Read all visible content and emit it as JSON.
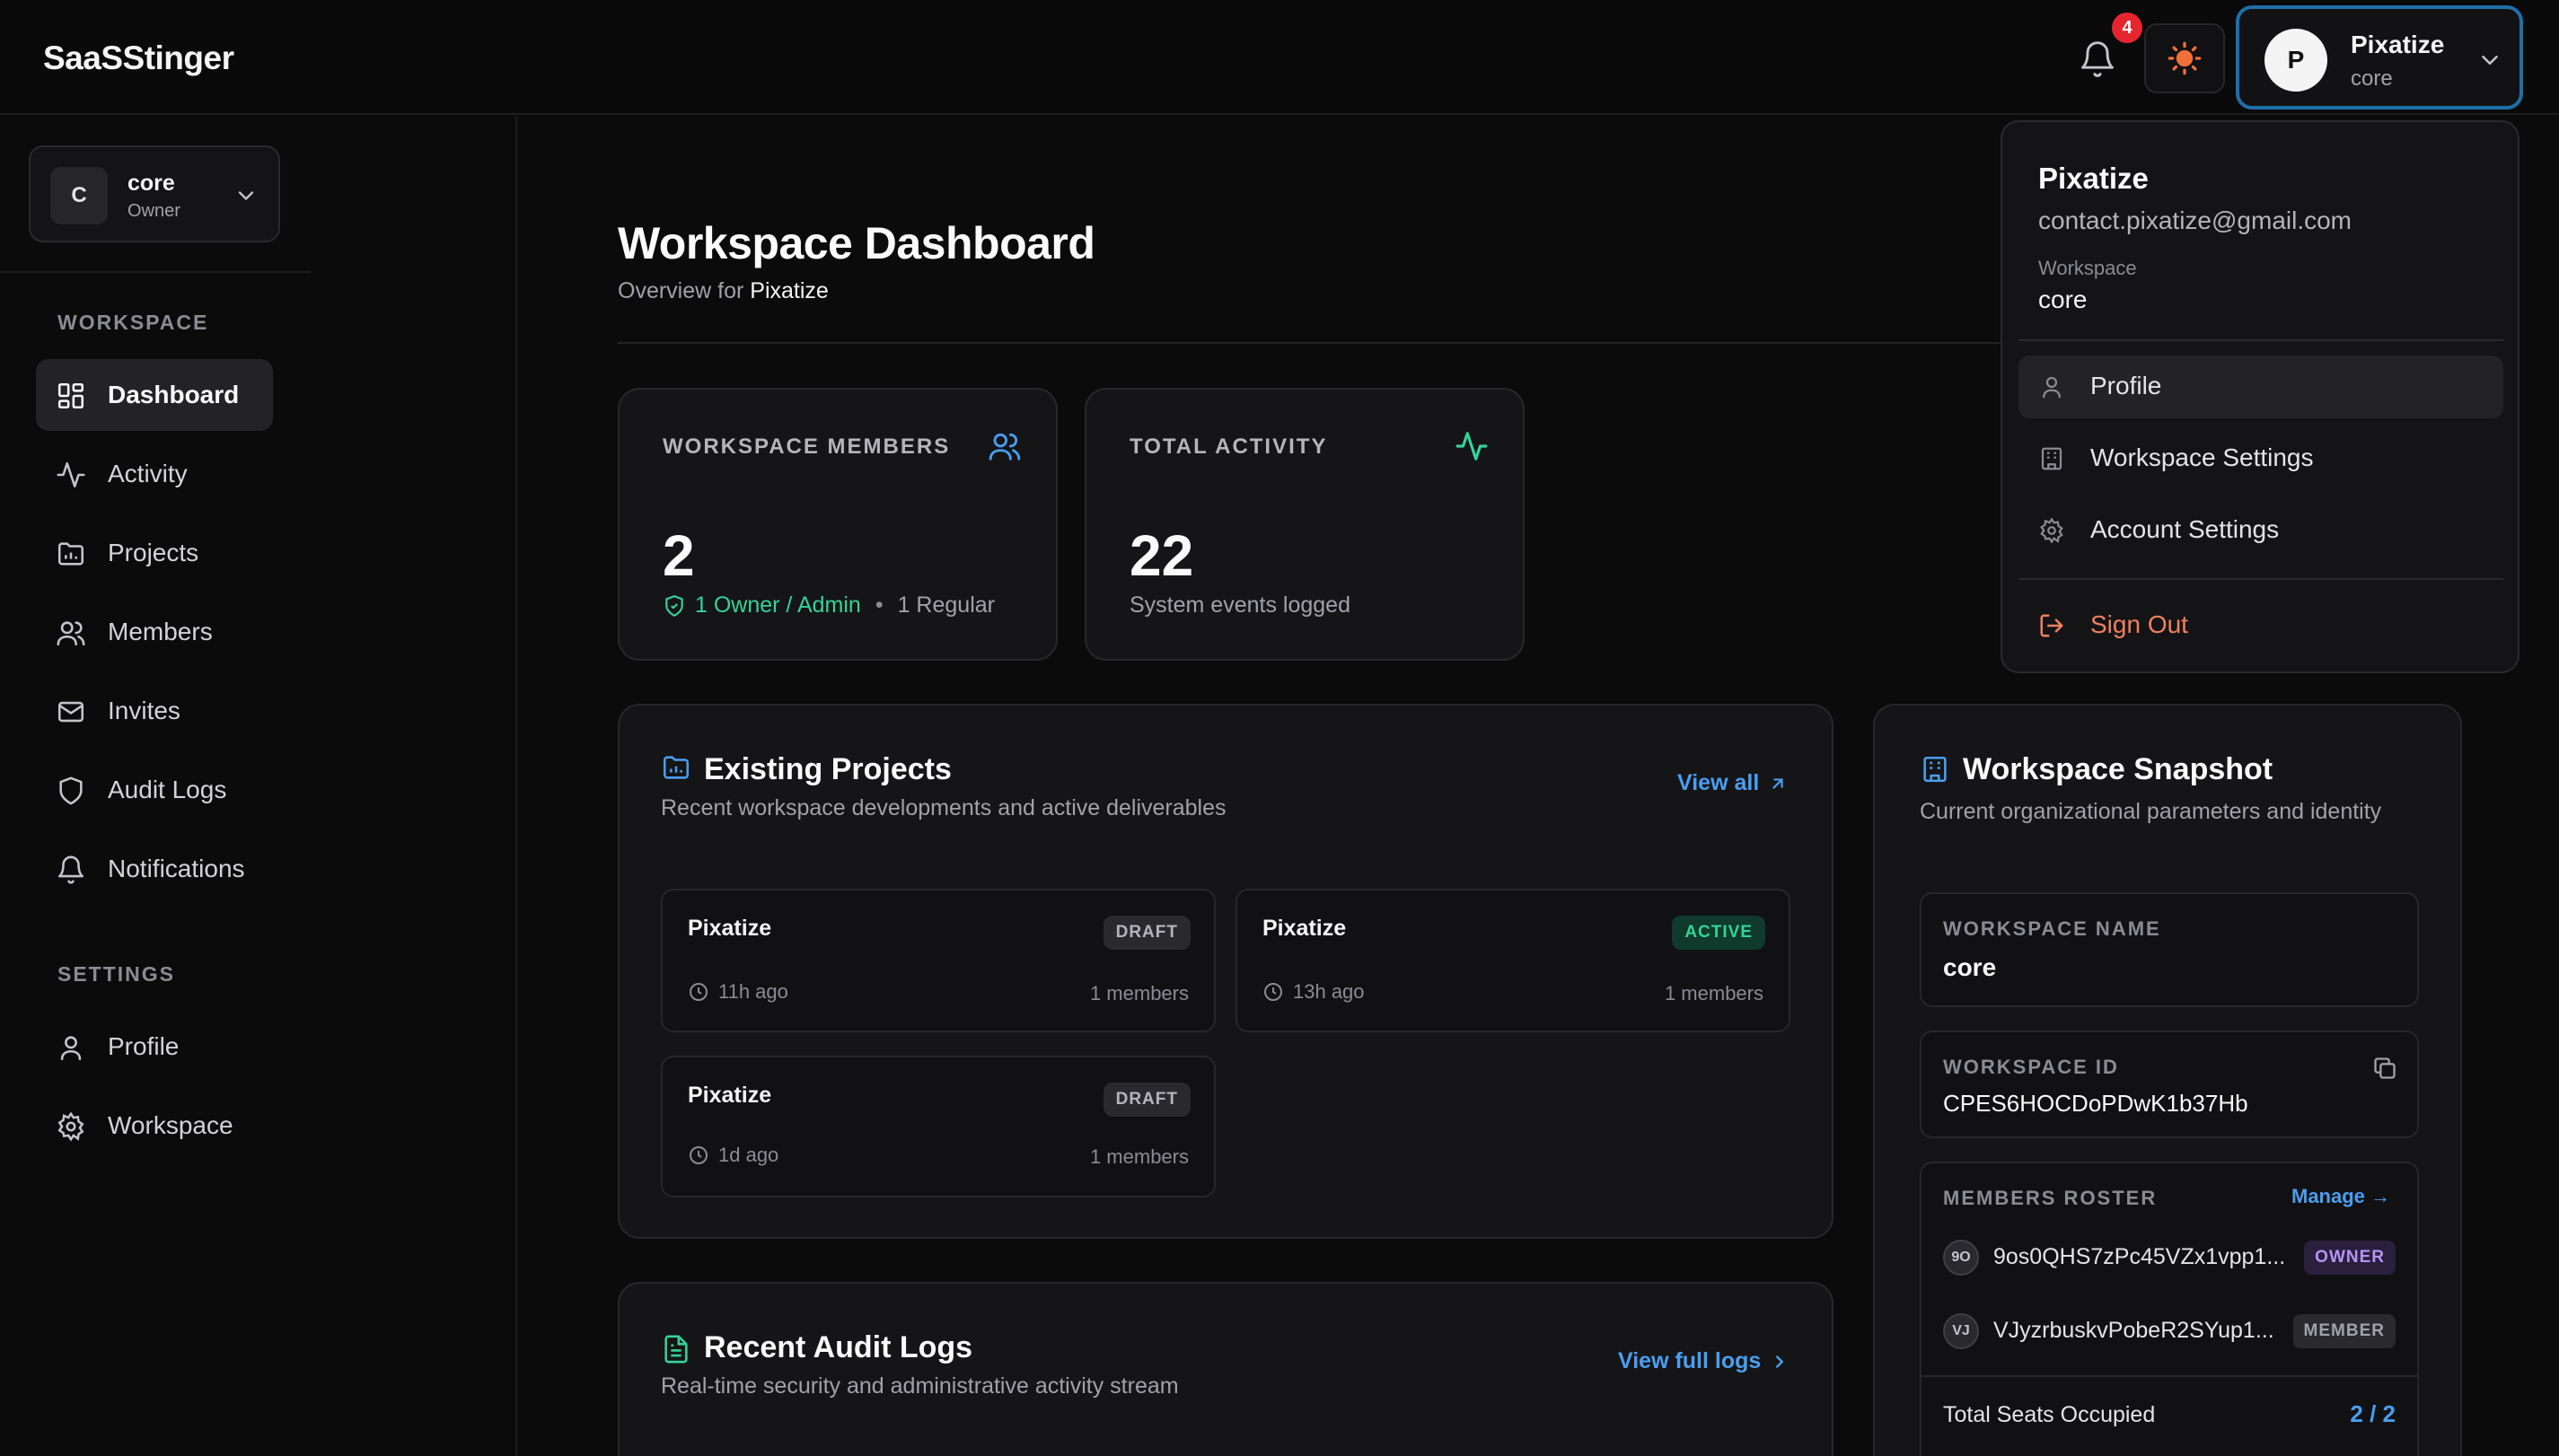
{
  "app": {
    "brand": "SaaSStinger"
  },
  "topbar": {
    "notification_count": "4",
    "user": {
      "initial": "P",
      "name": "Pixatize",
      "workspace": "core"
    }
  },
  "sidebar": {
    "workspace_switcher": {
      "initial": "C",
      "name": "core",
      "role": "Owner"
    },
    "sections": [
      {
        "title": "WORKSPACE",
        "items": [
          {
            "label": "Dashboard",
            "icon": "dashboard-icon",
            "active": true
          },
          {
            "label": "Activity",
            "icon": "activity-icon"
          },
          {
            "label": "Projects",
            "icon": "folder-icon"
          },
          {
            "label": "Members",
            "icon": "users-icon"
          },
          {
            "label": "Invites",
            "icon": "mail-icon"
          },
          {
            "label": "Audit Logs",
            "icon": "shield-icon"
          },
          {
            "label": "Notifications",
            "icon": "bell-icon"
          }
        ]
      },
      {
        "title": "SETTINGS",
        "items": [
          {
            "label": "Profile",
            "icon": "user-icon"
          },
          {
            "label": "Workspace",
            "icon": "gear-icon"
          }
        ]
      }
    ]
  },
  "main": {
    "title": "Workspace Dashboard",
    "subtitle_prefix": "Overview for",
    "subtitle_name": "Pixatize",
    "stats": {
      "members": {
        "label": "WORKSPACE MEMBERS",
        "value": "2",
        "owners": "1 Owner / Admin",
        "sep": "•",
        "regular": "1 Regular"
      },
      "activity": {
        "label": "TOTAL ACTIVITY",
        "value": "22",
        "foot": "System events logged"
      }
    },
    "projects": {
      "title": "Existing Projects",
      "subtitle": "Recent workspace developments and active deliverables",
      "view_all": "View all",
      "items": [
        {
          "name": "Pixatize",
          "status": "DRAFT",
          "time": "11h ago",
          "members": "1 members"
        },
        {
          "name": "Pixatize",
          "status": "ACTIVE",
          "time": "13h ago",
          "members": "1 members"
        },
        {
          "name": "Pixatize",
          "status": "DRAFT",
          "time": "1d ago",
          "members": "1 members"
        }
      ]
    },
    "audit": {
      "title": "Recent Audit Logs",
      "subtitle": "Real-time security and administrative activity stream",
      "view_full": "View full logs"
    },
    "snapshot": {
      "title": "Workspace Snapshot",
      "subtitle": "Current organizational parameters and identity",
      "name_label": "WORKSPACE NAME",
      "name_value": "core",
      "id_label": "WORKSPACE ID",
      "id_value": "CPES6HOCDoPDwK1b37Hb",
      "roster_label": "MEMBERS ROSTER",
      "manage": "Manage →",
      "members": [
        {
          "initials": "9O",
          "id": "9os0QHS7zPc45VZx1vpp1...",
          "role": "OWNER"
        },
        {
          "initials": "VJ",
          "id": "VJyzrbuskvPobeR2SYup1...",
          "role": "MEMBER"
        }
      ],
      "seats_label": "Total Seats Occupied",
      "seats_value": "2 / 2"
    }
  },
  "dropdown": {
    "name": "Pixatize",
    "email": "contact.pixatize@gmail.com",
    "workspace_label": "Workspace",
    "workspace_value": "core",
    "items": [
      {
        "label": "Profile",
        "icon": "user-icon"
      },
      {
        "label": "Workspace Settings",
        "icon": "building-icon"
      },
      {
        "label": "Account Settings",
        "icon": "gear-icon"
      }
    ],
    "sign_out": "Sign Out"
  },
  "colors": {
    "accent": "#4a9ef0",
    "success": "#34d399",
    "danger": "#f08060",
    "focus_ring": "#1f6fa8"
  }
}
